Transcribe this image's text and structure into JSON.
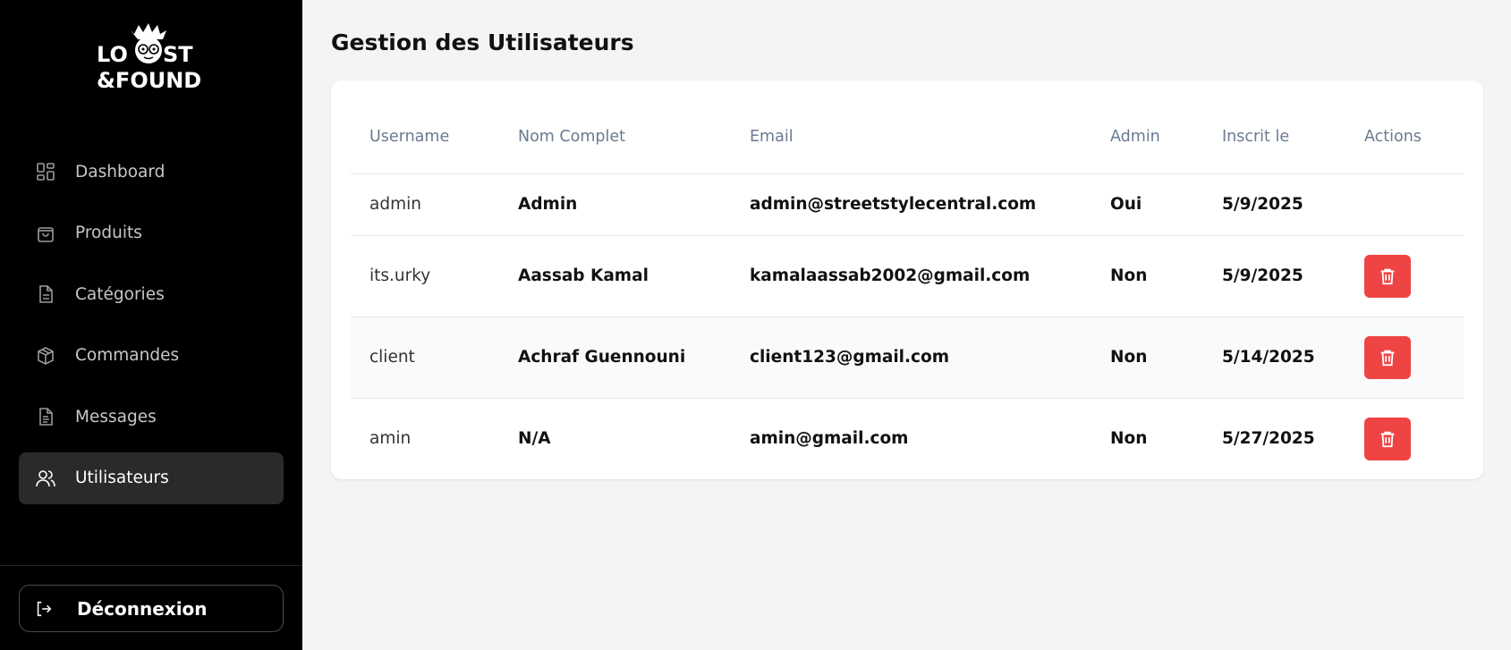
{
  "brand": {
    "line1": "LOOST",
    "line2": "&FOUND"
  },
  "nav": {
    "items": [
      {
        "label": "Dashboard",
        "icon": "dashboard-icon",
        "active": false
      },
      {
        "label": "Produits",
        "icon": "shopping-bag-icon",
        "active": false
      },
      {
        "label": "Catégories",
        "icon": "document-icon",
        "active": false
      },
      {
        "label": "Commandes",
        "icon": "package-icon",
        "active": false
      },
      {
        "label": "Messages",
        "icon": "message-document-icon",
        "active": false
      },
      {
        "label": "Utilisateurs",
        "icon": "users-icon",
        "active": true
      }
    ],
    "logout_label": "Déconnexion"
  },
  "page": {
    "title": "Gestion des Utilisateurs"
  },
  "table": {
    "headers": [
      "Username",
      "Nom Complet",
      "Email",
      "Admin",
      "Inscrit le",
      "Actions"
    ],
    "rows": [
      {
        "username": "admin",
        "full_name": "Admin",
        "email": "admin@streetstylecentral.com",
        "admin": "Oui",
        "registered": "5/9/2025",
        "can_delete": false
      },
      {
        "username": "its.urky",
        "full_name": "Aassab Kamal",
        "email": "kamalaassab2002@gmail.com",
        "admin": "Non",
        "registered": "5/9/2025",
        "can_delete": true
      },
      {
        "username": "client",
        "full_name": "Achraf Guennouni",
        "email": "client123@gmail.com",
        "admin": "Non",
        "registered": "5/14/2025",
        "can_delete": true
      },
      {
        "username": "amin",
        "full_name": "N/A",
        "email": "amin@gmail.com",
        "admin": "Non",
        "registered": "5/27/2025",
        "can_delete": true
      }
    ]
  },
  "colors": {
    "sidebar_bg": "#000000",
    "active_item_bg": "#2a2a2a",
    "delete_button": "#ef4444",
    "page_bg": "#f3f4f6"
  }
}
